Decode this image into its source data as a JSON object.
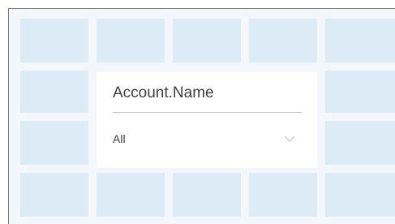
{
  "filter_card": {
    "title": "Account.Name",
    "selected_value": "All",
    "chevron_icon": "chevron-down-icon"
  },
  "colors": {
    "tile": "#dcebf5",
    "background": "#f3f6fb",
    "card": "#ffffff",
    "text": "#3e3e3c"
  }
}
